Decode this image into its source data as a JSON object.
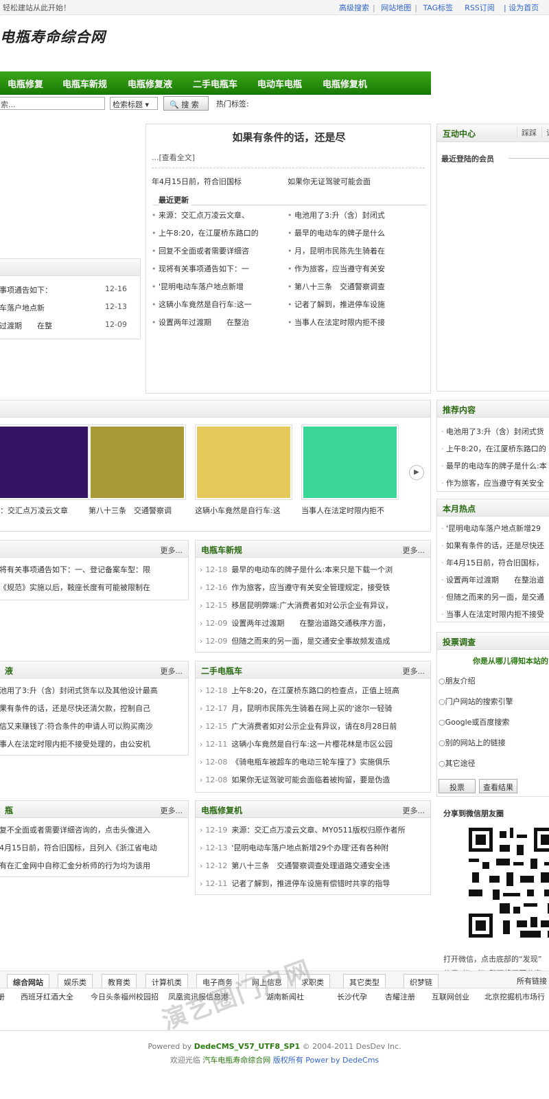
{
  "topbar": {
    "welcome": "轻松建站从此开始！",
    "links": [
      "高级搜索",
      "网站地图",
      "TAG标签",
      "RSS订阅"
    ],
    "set_home": "| 设为首页"
  },
  "logo": "电瓶寿命综合网",
  "nav": [
    "电瓶修复",
    "电瓶车新规",
    "电瓶修复液",
    "二手电瓶车",
    "电动车电瓶",
    "电瓶修复机"
  ],
  "search": {
    "placeholder": "索...",
    "select": "检索标题 ▾",
    "button": "搜 索",
    "hot": "热门标签:"
  },
  "focus": {
    "headline": "如果有条件的话，还是尽",
    "more": "...[查看全文]",
    "sub": [
      "年4月15日前，符合旧国标",
      "如果你无证驾驶可能会面"
    ],
    "latest_title": "最近更新",
    "latest_left": [
      "来源：交汇点万凌云文章、",
      "上午8:20，在江厦桥东路口的",
      "回复不全面或者需要详细咨",
      "现将有关事项通告如下：一",
      "'昆明电动车落户地点新增",
      "这辆小车竟然是自行车:这一",
      "设置两年过渡期　　在整治"
    ],
    "latest_right": [
      "电池用了3:升（含）封闭式",
      "最早的电动车的牌子是什么",
      "月，昆明市民陈先生骑着在",
      "作为旅客，应当遵守有关安",
      "第八十三条　交通警察调查",
      "记者了解到，推进停车设施",
      "当事人在法定时限内拒不接"
    ]
  },
  "left_list": [
    {
      "t": "事项通告如下：",
      "d": "12-16"
    },
    {
      "t": "车落户地点新",
      "d": "12-13"
    },
    {
      "t": "过渡期　　在整",
      "d": "12-09"
    }
  ],
  "interact": {
    "title": "互动中心",
    "tabs": [
      "踩踩",
      "评"
    ],
    "members": "最近登陆的会员"
  },
  "gallery": {
    "captions": [
      "源：交汇点万凌云文章",
      "第八十三条　交通警察调",
      "这辆小车竟然是自行车:这",
      "当事人在法定时限内拒不"
    ],
    "colors": [
      "#341463",
      "#a99a37",
      "#e5c95a",
      "#3ad696"
    ]
  },
  "recommend": {
    "title": "推荐内容",
    "items": [
      "电池用了3:升（含）封闭式货",
      "上午8:20，在江厦桥东路口的",
      "最早的电动车的牌子是什么:本",
      "作为旅客，应当遵守有关安全"
    ]
  },
  "hot": {
    "title": "本月热点",
    "items": [
      "'昆明电动车落户地点新增29",
      "如果有条件的话，还是尽快还",
      "年4月15日前，符合旧国标，",
      "设置两年过渡期　　在整治道",
      "但随之而来的另一面，是交通",
      "当事人在法定时限内拒不接受"
    ]
  },
  "vote": {
    "title": "投票调查",
    "question": "你是从哪儿得知本站的",
    "options": [
      "朋友介绍",
      "门户网站的搜索引擎",
      "Google或百度搜索",
      "别的网站上的链接",
      "其它途径"
    ],
    "btn_vote": "投票",
    "btn_result": "查看结果"
  },
  "share": {
    "title": "分享到微信朋友圈",
    "lines": [
      "打开微信，点击底部的“发现”",
      "使用“扫一扫”即可将网页分享"
    ]
  },
  "more_label": "更多...",
  "left_blocks": [
    {
      "title": "",
      "items": [
        "将有关事项通告如下：一、登记备案车型：限",
        "《规范》实施以后，鞍座长度有可能被限制在"
      ]
    },
    {
      "title": "液",
      "items": [
        "池用了3:升（含）封闭式货车以及其他设计最高",
        "果有条件的话，还是尽快还清欠款，控制自己",
        "信又来赚钱了:符合条件的申请人可以购买南沙",
        "事人在法定时限内拒不接受处理的，由公安机"
      ]
    },
    {
      "title": "瓶",
      "items": [
        "复不全面或者需要详细咨询的，点击头像进入",
        "4月15日前，符合旧国标，且列入《浙江省电动",
        "有在汇金网中自称汇金分析师的行为均为该用"
      ]
    }
  ],
  "mid_blocks": [
    {
      "title": "电瓶车新规",
      "items": [
        {
          "d": "12-18",
          "t": "最早的电动车的牌子是什么:本来只是下载一个浏"
        },
        {
          "d": "12-16",
          "t": "作为旅客，应当遵守有关安全管理规定，接受铁"
        },
        {
          "d": "12-15",
          "t": "移居昆明弊端:广大消费者如对公示企业有异议，"
        },
        {
          "d": "12-09",
          "t": "设置两年过渡期　　在整治道路交通秩序方面，"
        },
        {
          "d": "12-09",
          "t": "但随之而来的另一面，是交通安全事故频发造成"
        }
      ]
    },
    {
      "title": "二手电瓶车",
      "items": [
        {
          "d": "12-18",
          "t": "上午8:20，在江厦桥东路口的检查点，正值上班高"
        },
        {
          "d": "12-17",
          "t": "月，昆明市民陈先生骑着在网上买的'途尔一轻骑"
        },
        {
          "d": "12-15",
          "t": "广大消费者如对公示企业有异议，请在8月28日前"
        },
        {
          "d": "12-11",
          "t": "这辆小车竟然是自行车:这一片樱花林是市区公园"
        },
        {
          "d": "12-08",
          "t": "《骑电瓶车被超车的电动三轮车撞了》实施俱乐"
        },
        {
          "d": "12-08",
          "t": "如果你无证驾驶可能会面临着被拘留，要是伪造"
        }
      ]
    },
    {
      "title": "电瓶修复机",
      "items": [
        {
          "d": "12-19",
          "t": "来源：交汇点万凌云文章、MY0511版权归原作者所"
        },
        {
          "d": "12-13",
          "t": "'昆明电动车落户地点新增29个办理'还有各种附"
        },
        {
          "d": "12-12",
          "t": "第八十三条　交通警察调查处理道路交通安全违"
        },
        {
          "d": "12-11",
          "t": "记者了解到，推进停车设施有偿错时共享的指导"
        }
      ]
    }
  ],
  "links": {
    "tabs": [
      "综合网站",
      "娱乐类",
      "教育类",
      "计算机类",
      "电子商务",
      "网上信息",
      "求职类",
      "其它类型",
      "织梦链"
    ],
    "all": "所有链接",
    "items": [
      "册",
      "西班牙红酒大全",
      "今日头条福州校园招",
      "凤凰资讯报信息港",
      "湖南新闻社",
      "长沙代孕",
      "杏耀注册",
      "互联网创业",
      "北京挖掘机市场行"
    ]
  },
  "footer": {
    "line1_a": "Powered by ",
    "line1_b": "DedeCMS_V57_UTF8_SP1",
    "line1_c": " © 2004-2011 DesDev Inc.",
    "line2_a": "欢迎光临 ",
    "line2_b": "汽车电瓶寿命综合网",
    "line2_c": " 版权所有 Power by DedeCms"
  },
  "watermark": "演艺圈门户网"
}
